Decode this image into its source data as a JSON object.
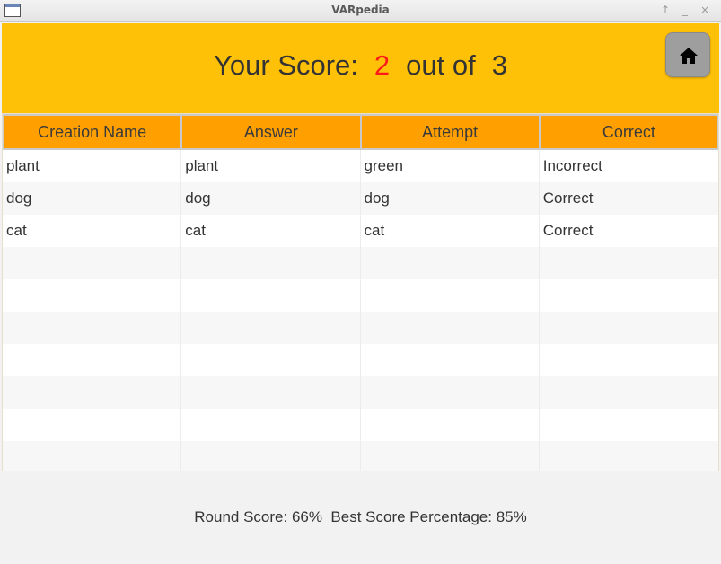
{
  "window": {
    "title": "VARpedia",
    "buttons": [
      "↑",
      "_",
      "×"
    ]
  },
  "header": {
    "score_label": "Your Score:",
    "score_value": "2",
    "out_of_label": "out of",
    "total_value": "3",
    "home_icon": "home-icon"
  },
  "table": {
    "headers": [
      "Creation Name",
      "Answer",
      "Attempt",
      "Correct"
    ],
    "rows": [
      [
        "plant",
        "plant",
        "green",
        "Incorrect"
      ],
      [
        "dog",
        "dog",
        "dog",
        "Correct"
      ],
      [
        "cat",
        "cat",
        "cat",
        "Correct"
      ]
    ]
  },
  "footer": {
    "round_score": "Round Score: 66%",
    "best_score": "Best Score Percentage: 85%"
  },
  "colors": {
    "header_bg": "#ffc107",
    "table_header_bg": "#ffa000",
    "score_highlight": "#ff1a1a"
  }
}
